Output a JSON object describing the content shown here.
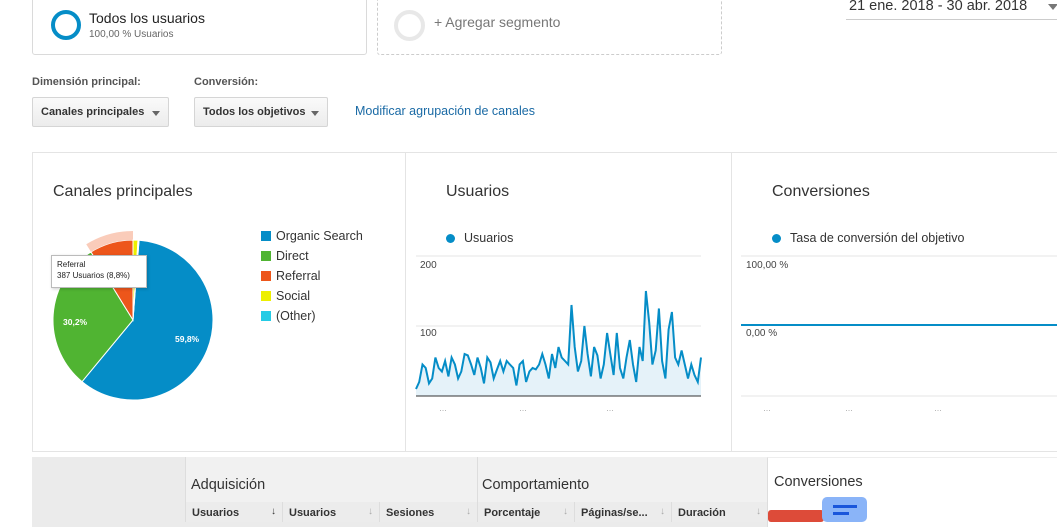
{
  "segments": {
    "active": {
      "title": "Todos los usuarios",
      "subtitle": "100,00 % Usuarios"
    },
    "add_label": "+ Agregar segmento"
  },
  "date_range": "21 ene. 2018 - 30 abr. 2018",
  "controls": {
    "primary_dimension_label": "Dimensión principal:",
    "primary_dimension_value": "Canales principales",
    "conversion_label": "Conversión:",
    "conversion_value": "Todos los objetivos",
    "modify_link": "Modificar agrupación de canales"
  },
  "panels": {
    "channels": {
      "title": "Canales principales",
      "tooltip_title": "Referral",
      "tooltip_value": "387 Usuarios (8,8%)",
      "slice_labels": {
        "organic": "59,8%",
        "direct": "30,2%"
      }
    },
    "users": {
      "title": "Usuarios",
      "legend": "Usuarios",
      "y_max": "200",
      "y_mid": "100"
    },
    "conversions": {
      "title": "Conversiones",
      "legend": "Tasa de conversión del objetivo",
      "y_max": "100,00 %",
      "y_min": "0,00 %"
    }
  },
  "colors": {
    "organic": "#058dc7",
    "direct": "#50b432",
    "referral": "#ed561b",
    "social": "#edef00",
    "other": "#24cbe5",
    "line": "#058dc7"
  },
  "chart_data": [
    {
      "type": "pie",
      "title": "Canales principales",
      "series": [
        {
          "name": "Organic Search",
          "value": 59.8
        },
        {
          "name": "Direct",
          "value": 30.2
        },
        {
          "name": "Referral",
          "value": 8.8
        },
        {
          "name": "Social",
          "value": 1.0
        },
        {
          "name": "(Other)",
          "value": 0.2
        }
      ]
    },
    {
      "type": "area",
      "title": "Usuarios",
      "ylim": [
        0,
        200
      ],
      "series": [
        {
          "name": "Usuarios",
          "values": [
            10,
            20,
            45,
            40,
            18,
            25,
            55,
            40,
            35,
            50,
            28,
            55,
            45,
            25,
            35,
            60,
            58,
            45,
            30,
            55,
            40,
            18,
            55,
            48,
            25,
            38,
            50,
            35,
            50,
            45,
            40,
            15,
            45,
            50,
            20,
            35,
            40,
            38,
            45,
            60,
            45,
            25,
            60,
            40,
            70,
            55,
            50,
            45,
            130,
            70,
            35,
            50,
            100,
            60,
            28,
            70,
            58,
            25,
            45,
            90,
            60,
            30,
            90,
            40,
            25,
            55,
            80,
            45,
            20,
            70,
            50,
            150,
            105,
            45,
            65,
            125,
            50,
            25,
            95,
            120,
            55,
            45,
            65,
            45,
            25,
            45,
            30,
            20,
            55
          ]
        }
      ]
    },
    {
      "type": "line",
      "title": "Conversiones",
      "ylim": [
        0,
        100
      ],
      "series": [
        {
          "name": "Tasa de conversión del objetivo",
          "values": [
            0,
            0
          ]
        }
      ]
    }
  ],
  "table": {
    "groups": {
      "acquisition": "Adquisición",
      "behavior": "Comportamiento",
      "conversions": "Conversiones"
    },
    "columns": [
      "Usuarios",
      "Usuarios",
      "Sesiones",
      "Porcentaje",
      "Páginas/se...",
      "Duración"
    ]
  }
}
